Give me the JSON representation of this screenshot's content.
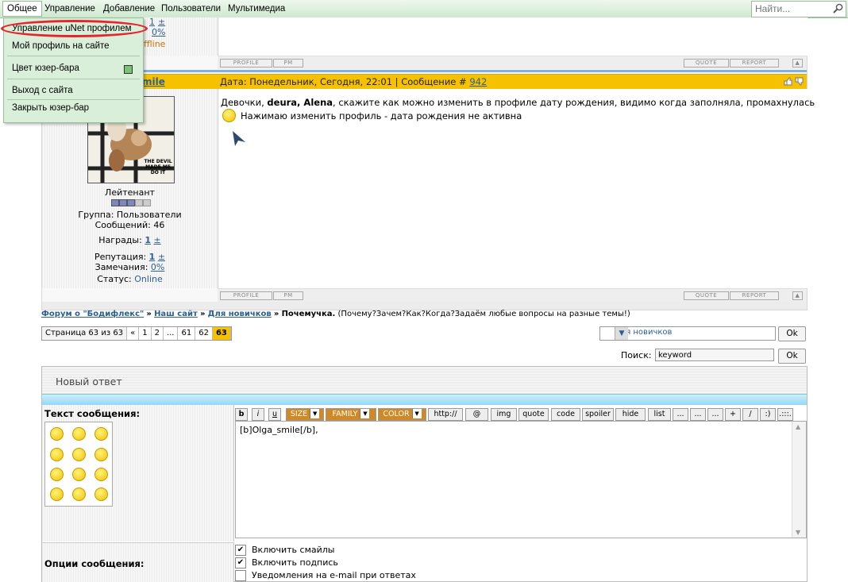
{
  "topbar": {
    "menu": [
      "Общее",
      "Управление",
      "Добавление",
      "Пользователи",
      "Мультимедиа"
    ],
    "search_placeholder": "Найти..."
  },
  "dropdown": {
    "items": [
      "Управление uNet профилем",
      "Мой профиль на сайте",
      "Цвет юзер-бара",
      "Выход с сайта",
      "Закрыть юзер-бар"
    ]
  },
  "prev_post": {
    "frag_1": "1",
    "frag_plus": "±",
    "frag_pct": "0%",
    "frag_status": "ffline"
  },
  "post_buttons": {
    "profile": "PROFILE",
    "pm": "PM",
    "quote": "QUOTE",
    "report": "REPORT"
  },
  "post": {
    "author_frag": "mile",
    "header": "Дата: Понедельник, Сегодня, 22:01 | Сообщение #",
    "num": "942",
    "line1_a": "Девочки, ",
    "line1_b": "deura, Alena",
    "line1_c": ", скажите как можно изменить в профиле дату рождения, видимо когда заполняла, промахнулась",
    "line2": "Нажимаю изменить профиль - дата рождения не активна",
    "avatar_caption": "THE DEVIL MADE ME DO IT",
    "rank": "Лейтенант",
    "group": "Группа: Пользователи",
    "posts": "Сообщений: 46",
    "awards_lbl": "Награды:",
    "awards_val": "1",
    "rep_lbl": "Репутация:",
    "rep_val": "1",
    "warn_lbl": "Замечания:",
    "warn_val": "0%",
    "status_lbl": "Статус:",
    "status_val": "Online",
    "plus": "±"
  },
  "breadcrumb": {
    "c1": "Форум о \"Бодифлекс\"",
    "sep": "»",
    "c2": "Наш сайт",
    "c3": "Для новичков",
    "c4": "Почемучка.",
    "desc": "(Почему?Зачем?Как?Когда?Задаём любые вопросы на разные темы!)"
  },
  "pagination": {
    "label": "Страница 63 из 63",
    "items": [
      "«",
      "1",
      "2",
      "...",
      "61",
      "62"
    ],
    "current": "63"
  },
  "forum_select": "Для новичков",
  "ok": "Ok",
  "search_label": "Поиск:",
  "search_value": "keyword",
  "reply": {
    "title": "Новый ответ",
    "text_label": "Текст сообщения:",
    "options_label": "Опции сообщения:",
    "toolbar": [
      "b",
      "i",
      "u",
      "SIZE",
      "FAMILY",
      "COLOR",
      "http://",
      "@",
      "img",
      "quote",
      "code",
      "spoiler",
      "hide",
      "list",
      "...",
      "...",
      "...",
      "+",
      "/",
      ":)",
      ".:::."
    ],
    "message": "[b]Olga_smile[/b],",
    "options": [
      "Включить смайлы",
      "Включить подпись",
      "Уведомления на e-mail при ответах"
    ]
  },
  "colors": {
    "accent": "#f5c100",
    "bar_green": "#d9efd9",
    "highlight": "#e8222e",
    "link": "#2b5e95"
  }
}
